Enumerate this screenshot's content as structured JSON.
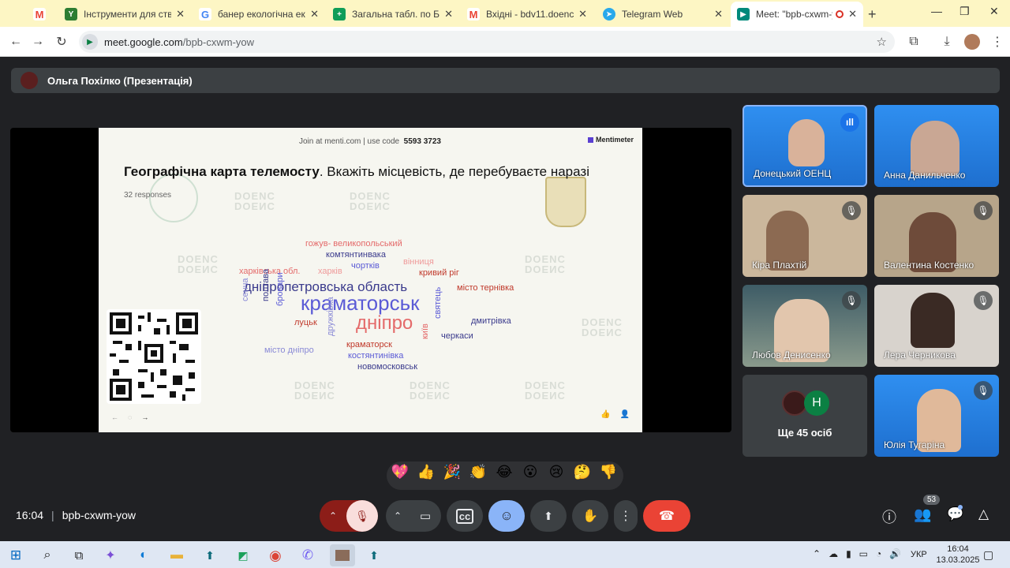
{
  "tabs": [
    {
      "label": "",
      "favicon": "gmail-icon",
      "color": "#ea4335"
    },
    {
      "label": "Інструменти для створе",
      "favicon": "y-icon",
      "color": "#2d7d32"
    },
    {
      "label": "банер екологічна експе",
      "favicon": "google-icon",
      "color": "#4285f4"
    },
    {
      "label": "Загальна табл. по БДВ -",
      "favicon": "sheets-icon",
      "color": "#0f9d58"
    },
    {
      "label": "Вхідні - bdv11.doenc@gr",
      "favicon": "gmail-icon",
      "color": "#ea4335"
    },
    {
      "label": "Telegram Web",
      "favicon": "telegram-icon",
      "color": "#29a9eb"
    },
    {
      "label": "Meet: \"bpb-cxwm-yo",
      "favicon": "meet-icon",
      "color": "#00897b"
    }
  ],
  "address": {
    "domain": "meet.google.com",
    "path": "/bpb-cxwm-yow"
  },
  "presenter": "Ольга Похілко (Презентація)",
  "slide": {
    "join_text": "Join at menti.com | use code",
    "code": "5593 3723",
    "brand": "Mentimeter",
    "title_bold": "Географічна карта телемосту",
    "title_rest": ". Вкажіть місцевість, де перебуваєте наразі",
    "responses": "32 responses",
    "watermark_top": "DOENC",
    "watermark_bottom": "DOENC"
  },
  "words": [
    {
      "t": "гожув- великопольський",
      "c": "#e46a6a",
      "s": 11
    },
    {
      "t": "комтянтинвака",
      "c": "#3a3a8c",
      "s": 11
    },
    {
      "t": "харківська обл.",
      "c": "#e46a6a",
      "s": 11
    },
    {
      "t": "харків",
      "c": "#ef9a9a",
      "s": 11
    },
    {
      "t": "чортків",
      "c": "#5b5bd6",
      "s": 11
    },
    {
      "t": "вінниця",
      "c": "#ef9a9a",
      "s": 11
    },
    {
      "t": "кривий ріг",
      "c": "#c0392b",
      "s": 11
    },
    {
      "t": "дніпропетровська область",
      "c": "#3a3a8c",
      "s": 17
    },
    {
      "t": "місто тернівка",
      "c": "#c0392b",
      "s": 11
    },
    {
      "t": "краматорськ",
      "c": "#5b5bd6",
      "s": 26
    },
    {
      "t": "сенча",
      "c": "#8a8ad6",
      "s": 11
    },
    {
      "t": "полтава",
      "c": "#3a3a8c",
      "s": 11
    },
    {
      "t": "бровари",
      "c": "#5b5bd6",
      "s": 11
    },
    {
      "t": "луцьк",
      "c": "#c0392b",
      "s": 11
    },
    {
      "t": "дніпро",
      "c": "#e46a6a",
      "s": 24
    },
    {
      "t": "дмитрівка",
      "c": "#3a3a8c",
      "s": 11
    },
    {
      "t": "святець",
      "c": "#5b5bd6",
      "s": 11
    },
    {
      "t": "черкаси",
      "c": "#3a3a8c",
      "s": 11
    },
    {
      "t": "місто дніпро",
      "c": "#8a8ad6",
      "s": 11
    },
    {
      "t": "дружківка",
      "c": "#8a8ad6",
      "s": 11
    },
    {
      "t": "краматорск",
      "c": "#c0392b",
      "s": 11
    },
    {
      "t": "київ",
      "c": "#e46a6a",
      "s": 11
    },
    {
      "t": "костянтинівка",
      "c": "#5b5bd6",
      "s": 11
    },
    {
      "t": "новомосковськ",
      "c": "#3a3a8c",
      "s": 11
    }
  ],
  "participants": [
    {
      "name": "Донецький ОЕНЦ",
      "speaking": true
    },
    {
      "name": "Анна Данильченко",
      "muted": false
    },
    {
      "name": "Кіра Плахтій",
      "muted": true
    },
    {
      "name": "Валентина Костенко",
      "muted": true
    },
    {
      "name": "Любов Денисенко",
      "muted": true
    },
    {
      "name": "Лера Черникова",
      "muted": true
    },
    {
      "name": "Юлія Тугаріна",
      "muted": true
    }
  ],
  "others": {
    "label": "Ще 45 осіб",
    "avatar_letter": "H"
  },
  "reactions": [
    "💖",
    "👍",
    "🎉",
    "👏",
    "😂",
    "😮",
    "😢",
    "🤔",
    "👎"
  ],
  "footer": {
    "time": "16:04",
    "meeting_code": "bpb-cxwm-yow",
    "people_count": "53"
  },
  "tray": {
    "lang": "УКР",
    "time": "16:04",
    "date": "13.03.2025"
  }
}
